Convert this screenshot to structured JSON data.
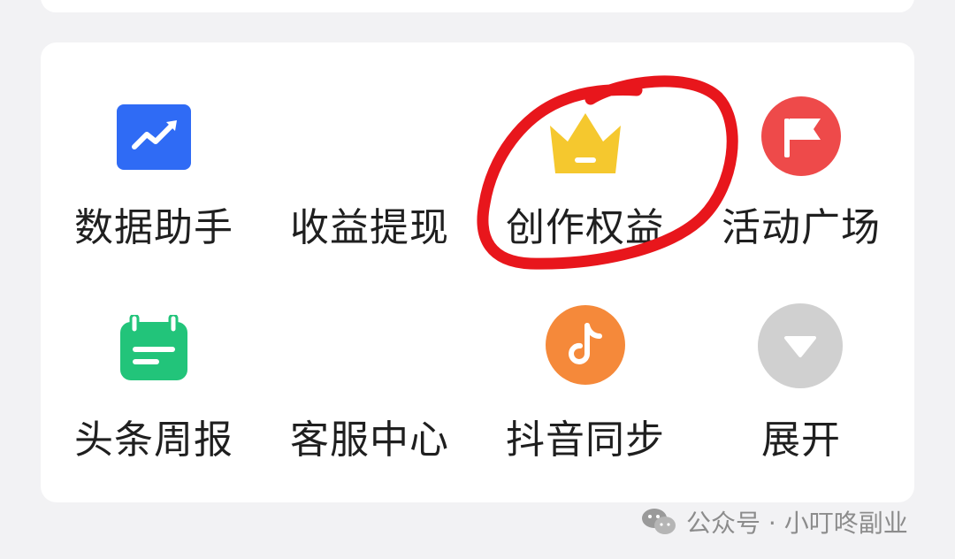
{
  "menu": {
    "items": [
      {
        "label": "数据助手",
        "icon": "trend-chart-icon",
        "color": "#2f6bf5"
      },
      {
        "label": "收益提现",
        "icon": "",
        "color": ""
      },
      {
        "label": "创作权益",
        "icon": "crown-icon",
        "color": "#f5c82e"
      },
      {
        "label": "活动广场",
        "icon": "flag-icon",
        "color": "#ee4a4a"
      },
      {
        "label": "头条周报",
        "icon": "calendar-icon",
        "color": "#22c47a"
      },
      {
        "label": "客服中心",
        "icon": "",
        "color": ""
      },
      {
        "label": "抖音同步",
        "icon": "tiktok-icon",
        "color": "#f5893a"
      },
      {
        "label": "展开",
        "icon": "expand-down-icon",
        "color": "#d0d0d0"
      }
    ]
  },
  "annotation": {
    "color": "#e8161c",
    "target": "创作权益"
  },
  "watermark": {
    "text": "公众号 · 小叮咚副业"
  }
}
